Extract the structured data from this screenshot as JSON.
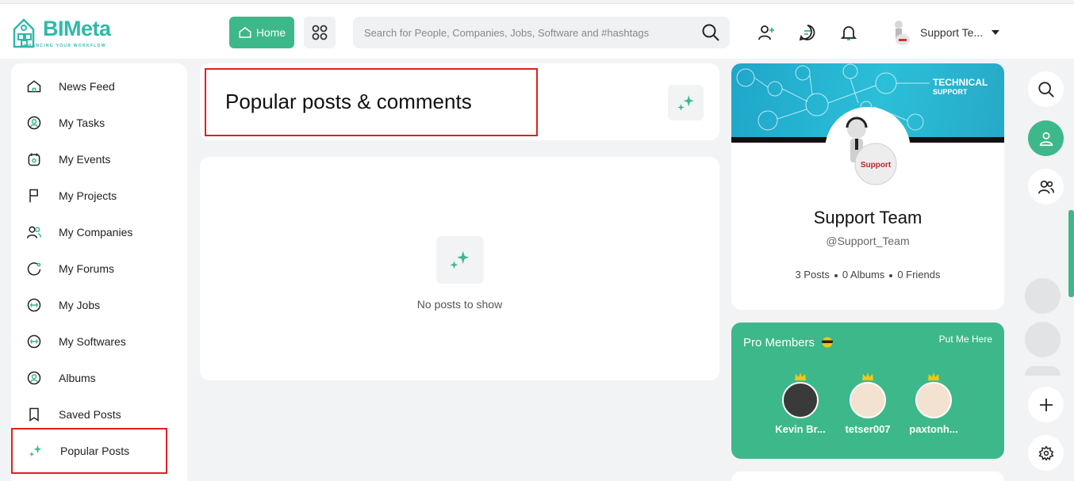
{
  "header": {
    "logo_text": "BIMeta",
    "logo_tagline": "ENHANCING YOUR WORKFLOW",
    "home_label": "Home",
    "search_placeholder": "Search for People, Companies, Jobs, Software and #hashtags",
    "user_name": "Support Te..."
  },
  "sidebar": {
    "items": [
      {
        "label": "News Feed",
        "icon": "home-icon"
      },
      {
        "label": "My Tasks",
        "icon": "task-icon"
      },
      {
        "label": "My Events",
        "icon": "calendar-icon"
      },
      {
        "label": "My Projects",
        "icon": "flag-icon"
      },
      {
        "label": "My Companies",
        "icon": "people-icon"
      },
      {
        "label": "My Forums",
        "icon": "forum-icon"
      },
      {
        "label": "My Jobs",
        "icon": "jobs-icon"
      },
      {
        "label": "My Softwares",
        "icon": "software-icon"
      },
      {
        "label": "Albums",
        "icon": "album-icon"
      },
      {
        "label": "Saved Posts",
        "icon": "bookmark-icon"
      },
      {
        "label": "Popular Posts",
        "icon": "sparkle-icon"
      }
    ]
  },
  "main": {
    "title": "Popular posts & comments",
    "empty_text": "No posts to show"
  },
  "profile": {
    "banner_title": "TECHNICAL",
    "banner_subtitle": "SUPPORT",
    "avatar_label": "Support",
    "name": "Support Team",
    "handle": "@Support_Team",
    "posts": "3 Posts",
    "albums": "0 Albums",
    "friends": "0 Friends"
  },
  "pro_members": {
    "title": "Pro Members",
    "link": "Put Me Here",
    "members": [
      {
        "name": "Kevin Br..."
      },
      {
        "name": "tetser007"
      },
      {
        "name": "paxtonh..."
      }
    ]
  },
  "colors": {
    "accent": "#3db88a",
    "brand": "#2fb9a8",
    "highlight": "#e02020"
  }
}
